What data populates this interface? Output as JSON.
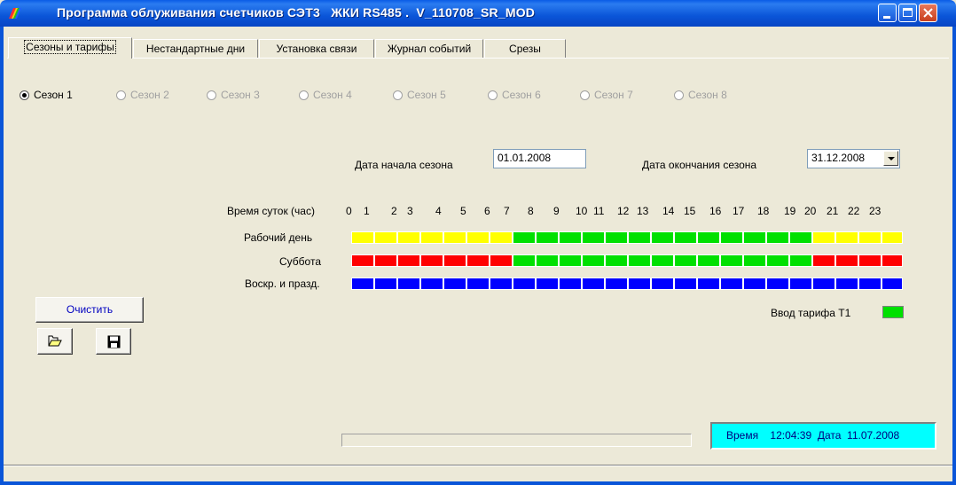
{
  "window": {
    "title": "Программа облуживания счетчиков СЭТ3   ЖКИ RS485 .  V_110708_SR_MOD"
  },
  "tabs": [
    {
      "label": "Сезоны и тарифы"
    },
    {
      "label": "Нестандартные дни"
    },
    {
      "label": "Установка связи"
    },
    {
      "label": "Журнал событий"
    },
    {
      "label": "Срезы"
    }
  ],
  "seasons": [
    {
      "label": "Сезон 1",
      "selected": true
    },
    {
      "label": "Сезон 2",
      "selected": false
    },
    {
      "label": "Сезон 3",
      "selected": false
    },
    {
      "label": "Сезон 4",
      "selected": false
    },
    {
      "label": "Сезон 5",
      "selected": false
    },
    {
      "label": "Сезон 6",
      "selected": false
    },
    {
      "label": "Сезон 7",
      "selected": false
    },
    {
      "label": "Сезон 8",
      "selected": false
    }
  ],
  "dates": {
    "start_label": "Дата начала сезона",
    "start_value": "01.01.2008",
    "end_label": "Дата окончания сезона",
    "end_value": "31.12.2008"
  },
  "schedule": {
    "hours_label": "Время суток (час)",
    "hours": [
      "0",
      "1",
      "2",
      "3",
      "4",
      "5",
      "6",
      "7",
      "8",
      "9",
      "10",
      "11",
      "12",
      "13",
      "14",
      "15",
      "16",
      "17",
      "18",
      "19",
      "20",
      "21",
      "22",
      "23"
    ],
    "colors": {
      "yellow": "#ffff00",
      "green": "#00e000",
      "red": "#ff0000",
      "blue": "#0000ff"
    },
    "rows": [
      {
        "label": "Рабочий день",
        "cells": [
          "yellow",
          "yellow",
          "yellow",
          "yellow",
          "yellow",
          "yellow",
          "yellow",
          "green",
          "green",
          "green",
          "green",
          "green",
          "green",
          "green",
          "green",
          "green",
          "green",
          "green",
          "green",
          "green",
          "yellow",
          "yellow",
          "yellow",
          "yellow"
        ]
      },
      {
        "label": "Суббота",
        "cells": [
          "red",
          "red",
          "red",
          "red",
          "red",
          "red",
          "red",
          "green",
          "green",
          "green",
          "green",
          "green",
          "green",
          "green",
          "green",
          "green",
          "green",
          "green",
          "green",
          "green",
          "red",
          "red",
          "red",
          "red"
        ]
      },
      {
        "label": "Воскр. и празд.",
        "cells": [
          "blue",
          "blue",
          "blue",
          "blue",
          "blue",
          "blue",
          "blue",
          "blue",
          "blue",
          "blue",
          "blue",
          "blue",
          "blue",
          "blue",
          "blue",
          "blue",
          "blue",
          "blue",
          "blue",
          "blue",
          "blue",
          "blue",
          "blue",
          "blue"
        ]
      }
    ]
  },
  "buttons": {
    "clear_label": "Очистить",
    "open_icon": "folder-open-icon",
    "save_icon": "floppy-disk-icon"
  },
  "tariff": {
    "label": "Ввод тарифа  Т1",
    "color": "#00e000"
  },
  "status": {
    "text": "Время    12:04:39  Дата  11.07.2008"
  }
}
